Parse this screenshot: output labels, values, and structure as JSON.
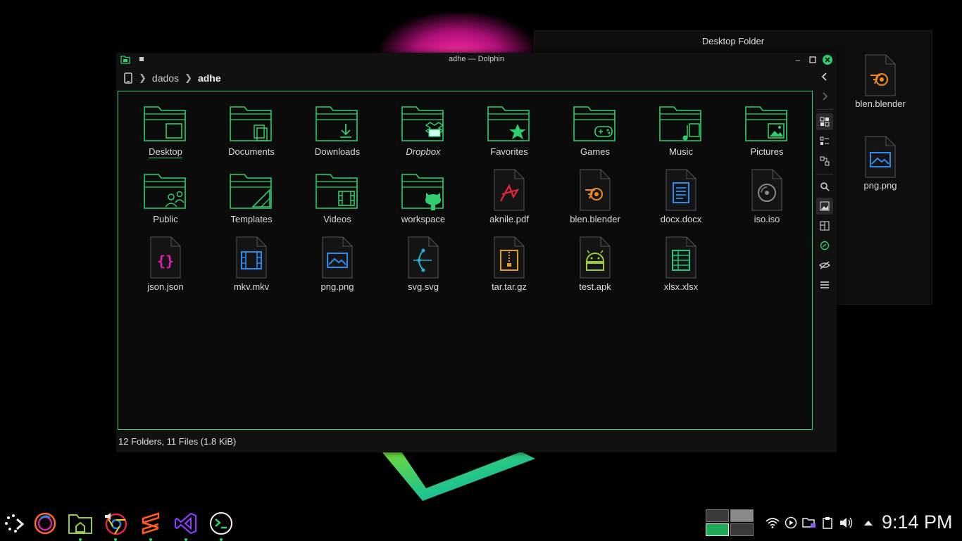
{
  "desktop_folder": {
    "title": "Desktop Folder",
    "items": [
      {
        "label": "blen.blender",
        "icon": "blender-file-icon"
      },
      {
        "label": "png.png",
        "icon": "image-file-icon"
      }
    ]
  },
  "window": {
    "title": "adhe — Dolphin",
    "breadcrumb": [
      "dados",
      "adhe"
    ],
    "status": "12 Folders, 11 Files (1.8 KiB)",
    "items": [
      {
        "label": "Desktop",
        "kind": "folder",
        "icon": "folder-desktop-icon"
      },
      {
        "label": "Documents",
        "kind": "folder",
        "icon": "folder-documents-icon"
      },
      {
        "label": "Downloads",
        "kind": "folder",
        "icon": "folder-downloads-icon"
      },
      {
        "label": "Dropbox",
        "kind": "folder",
        "icon": "folder-dropbox-icon"
      },
      {
        "label": "Favorites",
        "kind": "folder",
        "icon": "folder-favorites-icon"
      },
      {
        "label": "Games",
        "kind": "folder",
        "icon": "folder-games-icon"
      },
      {
        "label": "Music",
        "kind": "folder",
        "icon": "folder-music-icon"
      },
      {
        "label": "Pictures",
        "kind": "folder",
        "icon": "folder-pictures-icon"
      },
      {
        "label": "Public",
        "kind": "folder",
        "icon": "folder-public-icon"
      },
      {
        "label": "Templates",
        "kind": "folder",
        "icon": "folder-templates-icon"
      },
      {
        "label": "Videos",
        "kind": "folder",
        "icon": "folder-videos-icon"
      },
      {
        "label": "workspace",
        "kind": "folder",
        "icon": "folder-github-icon"
      },
      {
        "label": "aknile.pdf",
        "kind": "file",
        "icon": "pdf-file-icon"
      },
      {
        "label": "blen.blender",
        "kind": "file",
        "icon": "blender-file-icon"
      },
      {
        "label": "docx.docx",
        "kind": "file",
        "icon": "document-file-icon"
      },
      {
        "label": "iso.iso",
        "kind": "file",
        "icon": "disc-image-file-icon"
      },
      {
        "label": "json.json",
        "kind": "file",
        "icon": "json-file-icon"
      },
      {
        "label": "mkv.mkv",
        "kind": "file",
        "icon": "video-file-icon"
      },
      {
        "label": "png.png",
        "kind": "file",
        "icon": "image-file-icon"
      },
      {
        "label": "svg.svg",
        "kind": "file",
        "icon": "vector-file-icon"
      },
      {
        "label": "tar.tar.gz",
        "kind": "file",
        "icon": "archive-file-icon"
      },
      {
        "label": "test.apk",
        "kind": "file",
        "icon": "android-file-icon"
      },
      {
        "label": "xlsx.xlsx",
        "kind": "file",
        "icon": "spreadsheet-file-icon"
      }
    ]
  },
  "clock": "9:14 PM",
  "colors": {
    "accent": "#2fce6e",
    "blender": "#f08a24",
    "blue": "#2b8cf0",
    "pdf": "#e8253b",
    "json": "#e020b0",
    "svg": "#1bb6d6",
    "tar": "#e0a020",
    "apk": "#9acd32",
    "xlsx": "#22c77a"
  }
}
